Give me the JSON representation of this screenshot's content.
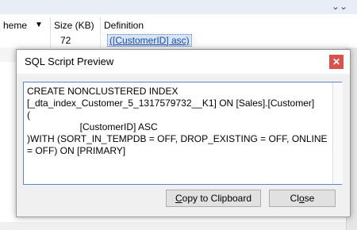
{
  "background_window": {
    "chevron_icon": "double-chevron-down",
    "columns": [
      "heme",
      "Size (KB)",
      "Definition"
    ],
    "rows": [
      {
        "c1": "",
        "size": "72",
        "definition": "([CustomerID] asc)"
      }
    ]
  },
  "dialog": {
    "title": "SQL Script Preview",
    "close_icon": "close-icon",
    "accent_color": "#d9524b",
    "sql_lines": [
      "CREATE NONCLUSTERED INDEX",
      "[_dta_index_Customer_5_1317579732__K1] ON [Sales].[Customer]",
      "(",
      "                    [CustomerID] ASC",
      ")WITH (SORT_IN_TEMPDB = OFF, DROP_EXISTING = OFF, ONLINE",
      "= OFF) ON [PRIMARY]"
    ],
    "copy_button": {
      "underline": "C",
      "rest": "opy to Clipboard"
    },
    "close_button": {
      "prefix": "Cl",
      "underline": "o",
      "rest": "se"
    }
  }
}
